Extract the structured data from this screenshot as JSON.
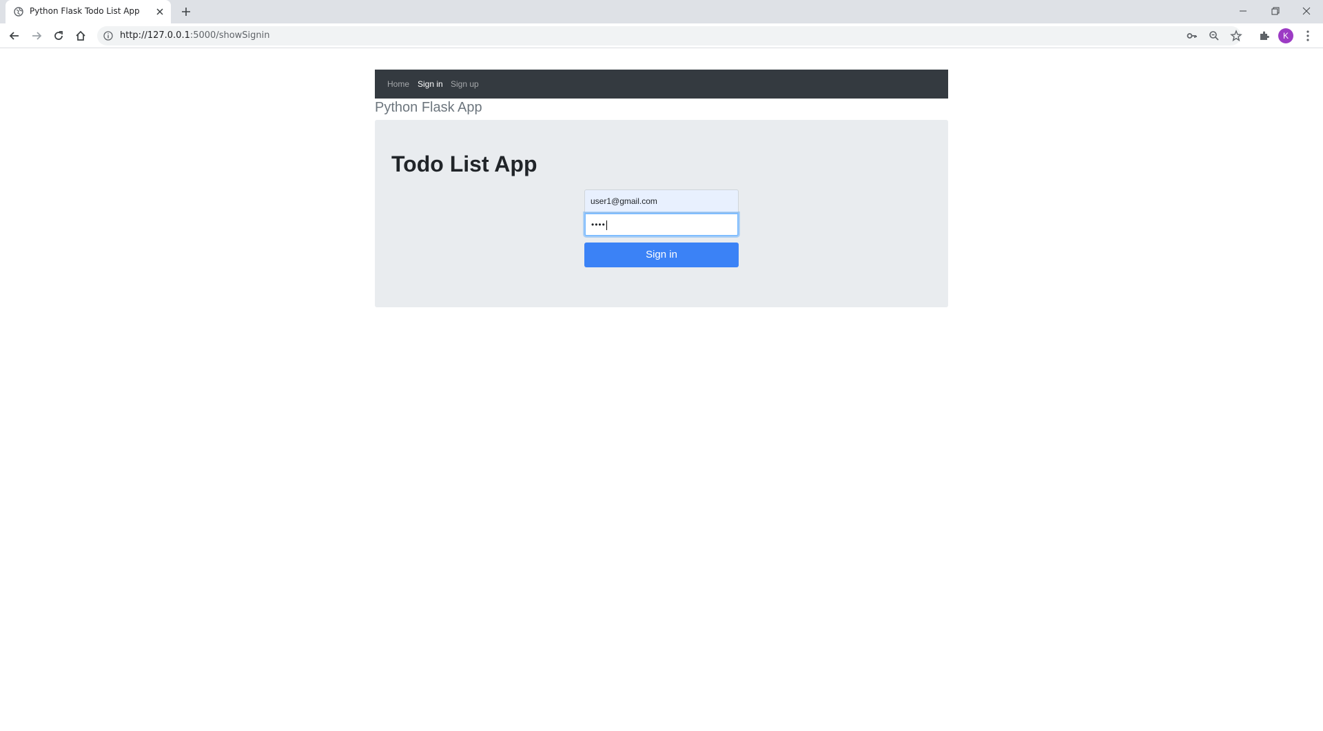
{
  "browser": {
    "tab_title": "Python Flask Todo List App",
    "url_host": "http://127.0.0.1",
    "url_rest": ":5000/showSignin",
    "profile_initial": "K",
    "icons": [
      "globe-icon",
      "close-icon",
      "plus-icon",
      "minimize-icon",
      "restore-icon",
      "close-window-icon",
      "back-icon",
      "forward-icon",
      "reload-icon",
      "home-icon",
      "info-icon",
      "key-icon",
      "zoom-icon",
      "star-icon",
      "extensions-icon",
      "menu-icon"
    ]
  },
  "navbar": {
    "items": [
      {
        "label": "Home",
        "active": false
      },
      {
        "label": "Sign in",
        "active": true
      },
      {
        "label": "Sign up",
        "active": false
      }
    ]
  },
  "brand": "Python Flask App",
  "jumbotron": {
    "title": "Todo List App",
    "email_value": "user1@gmail.com",
    "password_value": "••••",
    "submit_label": "Sign in"
  },
  "colors": {
    "navbar_bg": "#343a40",
    "jumbotron_bg": "#e9ecef",
    "button_bg": "#3b82f6",
    "avatar_bg": "#9c3bc4"
  }
}
